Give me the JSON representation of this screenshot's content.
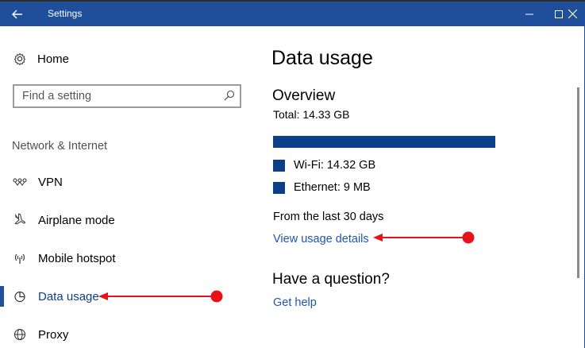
{
  "window": {
    "title": "Settings",
    "controls": {
      "minimize": "minimize-icon",
      "maximize": "maximize-icon",
      "close": "close-icon"
    }
  },
  "sidebar": {
    "home_label": "Home",
    "search_placeholder": "Find a setting",
    "section_label": "Network & Internet",
    "items": [
      {
        "label": "VPN",
        "icon": "vpn-icon"
      },
      {
        "label": "Airplane mode",
        "icon": "airplane-icon"
      },
      {
        "label": "Mobile hotspot",
        "icon": "hotspot-icon"
      },
      {
        "label": "Data usage",
        "icon": "data-usage-icon",
        "active": true
      },
      {
        "label": "Proxy",
        "icon": "globe-icon"
      }
    ]
  },
  "main": {
    "title": "Data usage",
    "overview_heading": "Overview",
    "total": "Total: 14.33 GB",
    "legend": [
      {
        "label": "Wi-Fi: 14.32 GB"
      },
      {
        "label": "Ethernet: 9 MB"
      }
    ],
    "period": "From the last 30 days",
    "details_link": "View usage details",
    "question_heading": "Have a question?",
    "help_link": "Get help"
  },
  "colors": {
    "titlebar": "#1f4e9a",
    "accent": "#0b3f8a",
    "link": "#1f55b4",
    "annotation": "#e8101a"
  }
}
